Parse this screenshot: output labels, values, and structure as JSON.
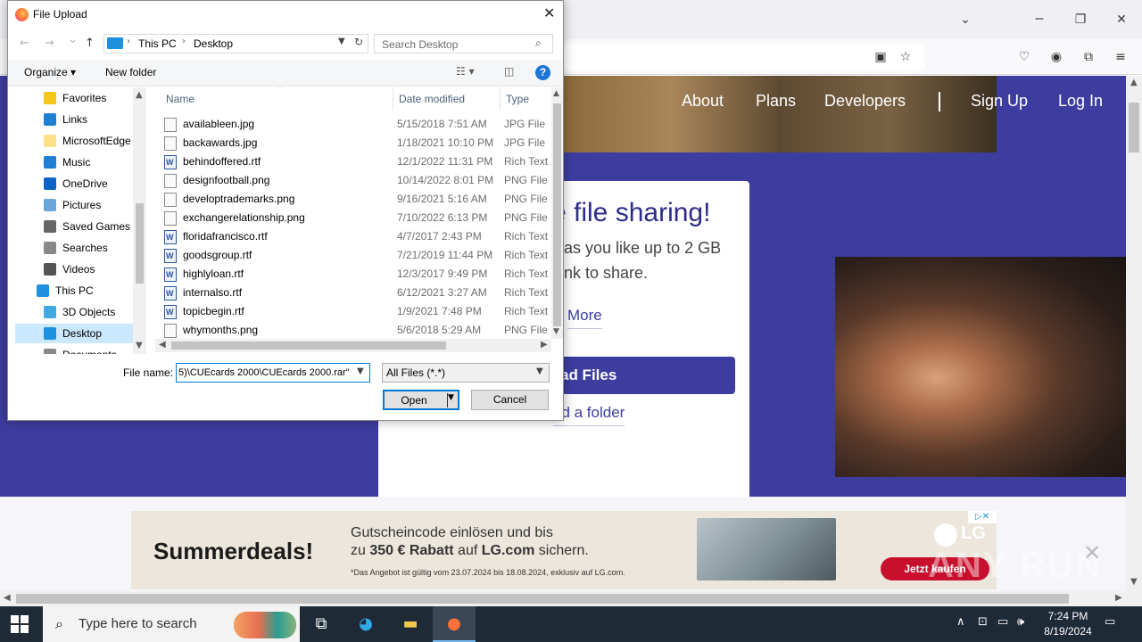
{
  "dialog": {
    "title": "File Upload",
    "close_glyph": "✕",
    "nav": {
      "back": "←",
      "forward": "→",
      "recent": "⌄",
      "up": "↑"
    },
    "address": {
      "root": "This PC",
      "folder": "Desktop",
      "sep": "›"
    },
    "search_placeholder": "Search Desktop",
    "command_bar": {
      "organize": "Organize ▾",
      "new_folder": "New folder",
      "help": "?"
    },
    "nav_pane": [
      {
        "label": "Favorites",
        "icon": "star-icon",
        "color": "#f5c518"
      },
      {
        "label": "Links",
        "icon": "link-icon",
        "color": "#1e7fd4"
      },
      {
        "label": "MicrosoftEdge",
        "icon": "folder-icon",
        "color": "#ffe08a"
      },
      {
        "label": "Music",
        "icon": "music-icon",
        "color": "#1e7fd4"
      },
      {
        "label": "OneDrive",
        "icon": "cloud-icon",
        "color": "#0a63c4"
      },
      {
        "label": "Pictures",
        "icon": "pictures-icon",
        "color": "#6aa6d9"
      },
      {
        "label": "Saved Games",
        "icon": "games-icon",
        "color": "#666666"
      },
      {
        "label": "Searches",
        "icon": "search-icon",
        "color": "#888888"
      },
      {
        "label": "Videos",
        "icon": "videos-icon",
        "color": "#555555"
      },
      {
        "label": "This PC",
        "icon": "computer-icon",
        "color": "#1e90e0"
      },
      {
        "label": "3D Objects",
        "icon": "cube-icon",
        "color": "#3fa9e0"
      },
      {
        "label": "Desktop",
        "icon": "desktop-icon",
        "color": "#1e90e0",
        "selected": true
      },
      {
        "label": "Documents",
        "icon": "documents-icon",
        "color": "#888888"
      }
    ],
    "columns": {
      "name": "Name",
      "date": "Date modified",
      "type": "Type"
    },
    "files": [
      {
        "name": "availableen.jpg",
        "date": "5/15/2018 7:51 AM",
        "type": "JPG File",
        "kind": "img"
      },
      {
        "name": "backawards.jpg",
        "date": "1/18/2021 10:10 PM",
        "type": "JPG File",
        "kind": "img"
      },
      {
        "name": "behindoffered.rtf",
        "date": "12/1/2022 11:31 PM",
        "type": "Rich Text",
        "kind": "rtf"
      },
      {
        "name": "designfootball.png",
        "date": "10/14/2022 8:01 PM",
        "type": "PNG File",
        "kind": "img"
      },
      {
        "name": "developtrademarks.png",
        "date": "9/16/2021 5:16 AM",
        "type": "PNG File",
        "kind": "img"
      },
      {
        "name": "exchangerelationship.png",
        "date": "7/10/2022 6:13 PM",
        "type": "PNG File",
        "kind": "img"
      },
      {
        "name": "floridafrancisco.rtf",
        "date": "4/7/2017 2:43 PM",
        "type": "Rich Text",
        "kind": "rtf"
      },
      {
        "name": "goodsgroup.rtf",
        "date": "7/21/2019 11:44 PM",
        "type": "Rich Text",
        "kind": "rtf"
      },
      {
        "name": "highlyloan.rtf",
        "date": "12/3/2017 9:49 PM",
        "type": "Rich Text",
        "kind": "rtf"
      },
      {
        "name": "internalso.rtf",
        "date": "6/12/2021 3:27 AM",
        "type": "Rich Text",
        "kind": "rtf"
      },
      {
        "name": "topicbegin.rtf",
        "date": "1/9/2021 7:48 PM",
        "type": "Rich Text",
        "kind": "rtf"
      },
      {
        "name": "whymonths.png",
        "date": "5/6/2018 5:29 AM",
        "type": "PNG File",
        "kind": "img"
      }
    ],
    "file_name_label": "File name:",
    "file_name_value": "5)\\CUEcards 2000\\CUEcards 2000.rar\"",
    "file_type": "All Files (*.*)",
    "open_label": "Open",
    "cancel_label": "Cancel"
  },
  "browser": {
    "tab_overflow": "⌄",
    "window": {
      "minimize": "─",
      "restore": "❐",
      "close": "✕"
    },
    "toolbar_icons": [
      "reader-view-icon",
      "bookmark-star-icon",
      "pocket-icon",
      "account-icon",
      "extensions-icon",
      "menu-icon"
    ]
  },
  "site": {
    "nav": {
      "about": "About",
      "plans": "Plans",
      "developers": "Developers",
      "signup": "Sign Up",
      "login": "Log In"
    },
    "headline": "e file sharing!",
    "line1": "as you like up to 2 GB",
    "line2": "nk to share.",
    "more": "More",
    "upload_button": "ad Files",
    "upload_folder": "ad a folder"
  },
  "ad": {
    "headline": "Summerdeals!",
    "line1": "Gutscheincode einlösen und bis",
    "line2_prefix": "zu ",
    "line2_bold": "350 € Rabatt",
    "line2_mid": " auf ",
    "line2_site": "LG.com",
    "line2_suffix": " sichern.",
    "fine_print": "*Das Angebot ist gültig vom 23.07.2024 bis 18.08.2024, exklusiv auf LG.com.",
    "brand": "LG",
    "cta": "Jetzt kaufen",
    "badge": "▷✕"
  },
  "watermark": "ANY RUN",
  "taskbar": {
    "search_placeholder": "Type here to search",
    "time": "7:24 PM",
    "date": "8/19/2024"
  }
}
